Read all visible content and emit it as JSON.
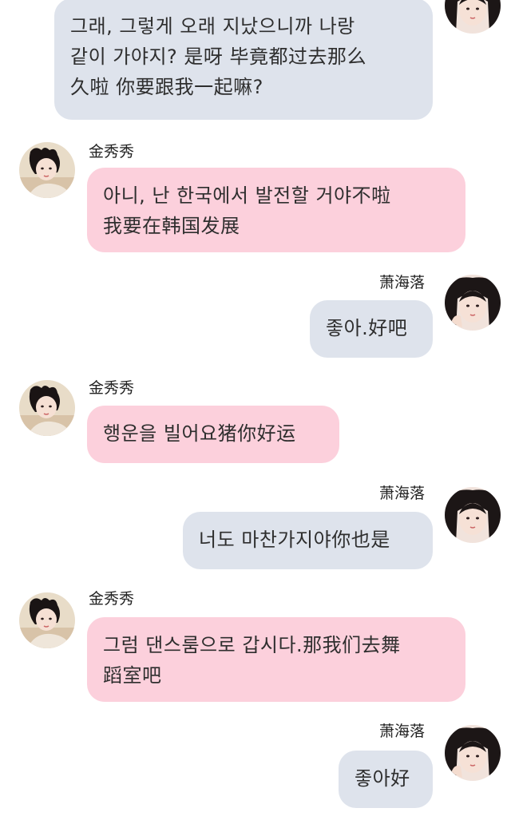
{
  "chat": {
    "participants": {
      "left": "金秀秀",
      "right": "萧海落"
    },
    "messages": [
      {
        "side": "right",
        "lines": [
          "그래, 그렇게 오래 지났으니까 나랑",
          "같이 가야지? 是呀 毕竟都过去那么",
          "久啦 你要跟我一起嘛?"
        ]
      },
      {
        "side": "left",
        "name": "金秀秀",
        "lines": [
          "아니, 난 한국에서 발전할 거야不啦",
          "我要在韩国发展"
        ]
      },
      {
        "side": "right",
        "name": "萧海落",
        "lines": [
          "좋아.好吧"
        ]
      },
      {
        "side": "left",
        "name": "金秀秀",
        "lines": [
          "행운을 빌어요猪你好运"
        ]
      },
      {
        "side": "right",
        "name": "萧海落",
        "lines": [
          "너도 마찬가지야你也是"
        ]
      },
      {
        "side": "left",
        "name": "金秀秀",
        "lines": [
          "그럼 댄스룸으로 갑시다.那我们去舞",
          "蹈室吧"
        ]
      },
      {
        "side": "right",
        "name": "萧海落",
        "lines": [
          "좋아好"
        ]
      }
    ]
  },
  "colors": {
    "left_bubble": "#fcd0dc",
    "right_bubble": "#dee3ec"
  }
}
